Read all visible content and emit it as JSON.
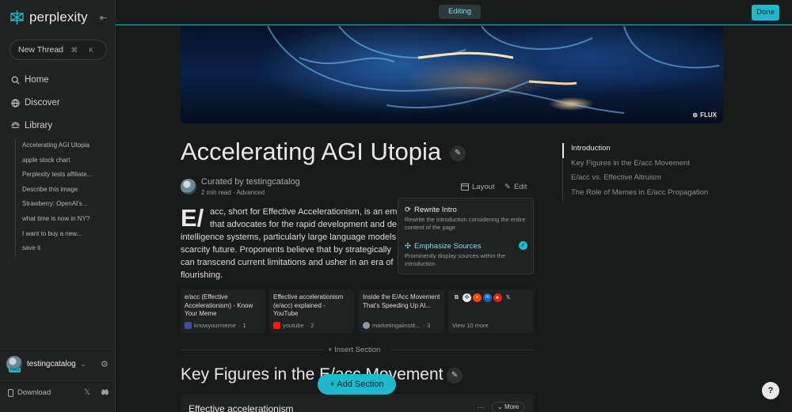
{
  "app": {
    "logo_text": "perplexity"
  },
  "sidebar": {
    "new_thread": "New Thread",
    "shortcut": "⌘ K",
    "nav": [
      {
        "label": "Home",
        "icon": "search-icon"
      },
      {
        "label": "Discover",
        "icon": "globe-icon"
      },
      {
        "label": "Library",
        "icon": "library-icon"
      }
    ],
    "history": [
      "Accelerating AGI Utopia",
      "apple stock chart",
      "Perplexity tests affiliate...",
      "Describe this image",
      "Strawberry: OpenAI's...",
      "what time is now in NY?",
      "I want to buy a new...",
      "save it"
    ],
    "user": {
      "name": "testingcatalog",
      "badge": "PRO"
    },
    "download": "Download"
  },
  "topbar": {
    "status": "Editing",
    "done": "Done"
  },
  "hero": {
    "label": "FLUX"
  },
  "page": {
    "title": "Accelerating AGI Utopia",
    "curated_by": "Curated by testingcatalog",
    "meta": "2 min read · Advanced",
    "layout_label": "Layout",
    "edit_label": "Edit",
    "dropcap": "E/",
    "lines": [
      "acc, short for Effective Accelerationism, is an em",
      "that advocates for the rapid development and de",
      "intelligence systems, particularly large language models",
      "scarcity future. Proponents believe that by strategically",
      "can transcend current limitations and usher in an era of",
      "flourishing."
    ]
  },
  "popup": {
    "options": [
      {
        "title": "Rewrite Intro",
        "desc": "Rewrite the introduction considering the entire content of the page",
        "selected": false
      },
      {
        "title": "Emphasize Sources",
        "desc": "Prominently display sources within the introduction",
        "selected": true
      }
    ]
  },
  "sources": [
    {
      "title": "e/acc (Effective Accelerationism) - Know Your Meme",
      "site": "knowyourmeme",
      "num": "1"
    },
    {
      "title": "Effective accelerationism (e/acc) explained - YouTube",
      "site": "youtube",
      "num": "2"
    },
    {
      "title": "Inside the E/Acc Movement That's Speeding Up AI...",
      "site": "marketingaiinstit...",
      "num": "3"
    }
  ],
  "view_more": "View 10 more",
  "insert_section": "Insert Section",
  "section": {
    "heading": "Key Figures in the E/acc Movement",
    "add_section": "Add Section",
    "card_title": "Effective accelerationism",
    "more": "More"
  },
  "toc": [
    "Introduction",
    "Key Figures in the E/acc Movement",
    "E/acc vs. Effective Altruism",
    "The Role of Memes in E/acc Propagation"
  ],
  "help": "?",
  "colors": {
    "accent": "#1fb8cd",
    "background": "#191a1a",
    "sidebar": "#202222"
  }
}
